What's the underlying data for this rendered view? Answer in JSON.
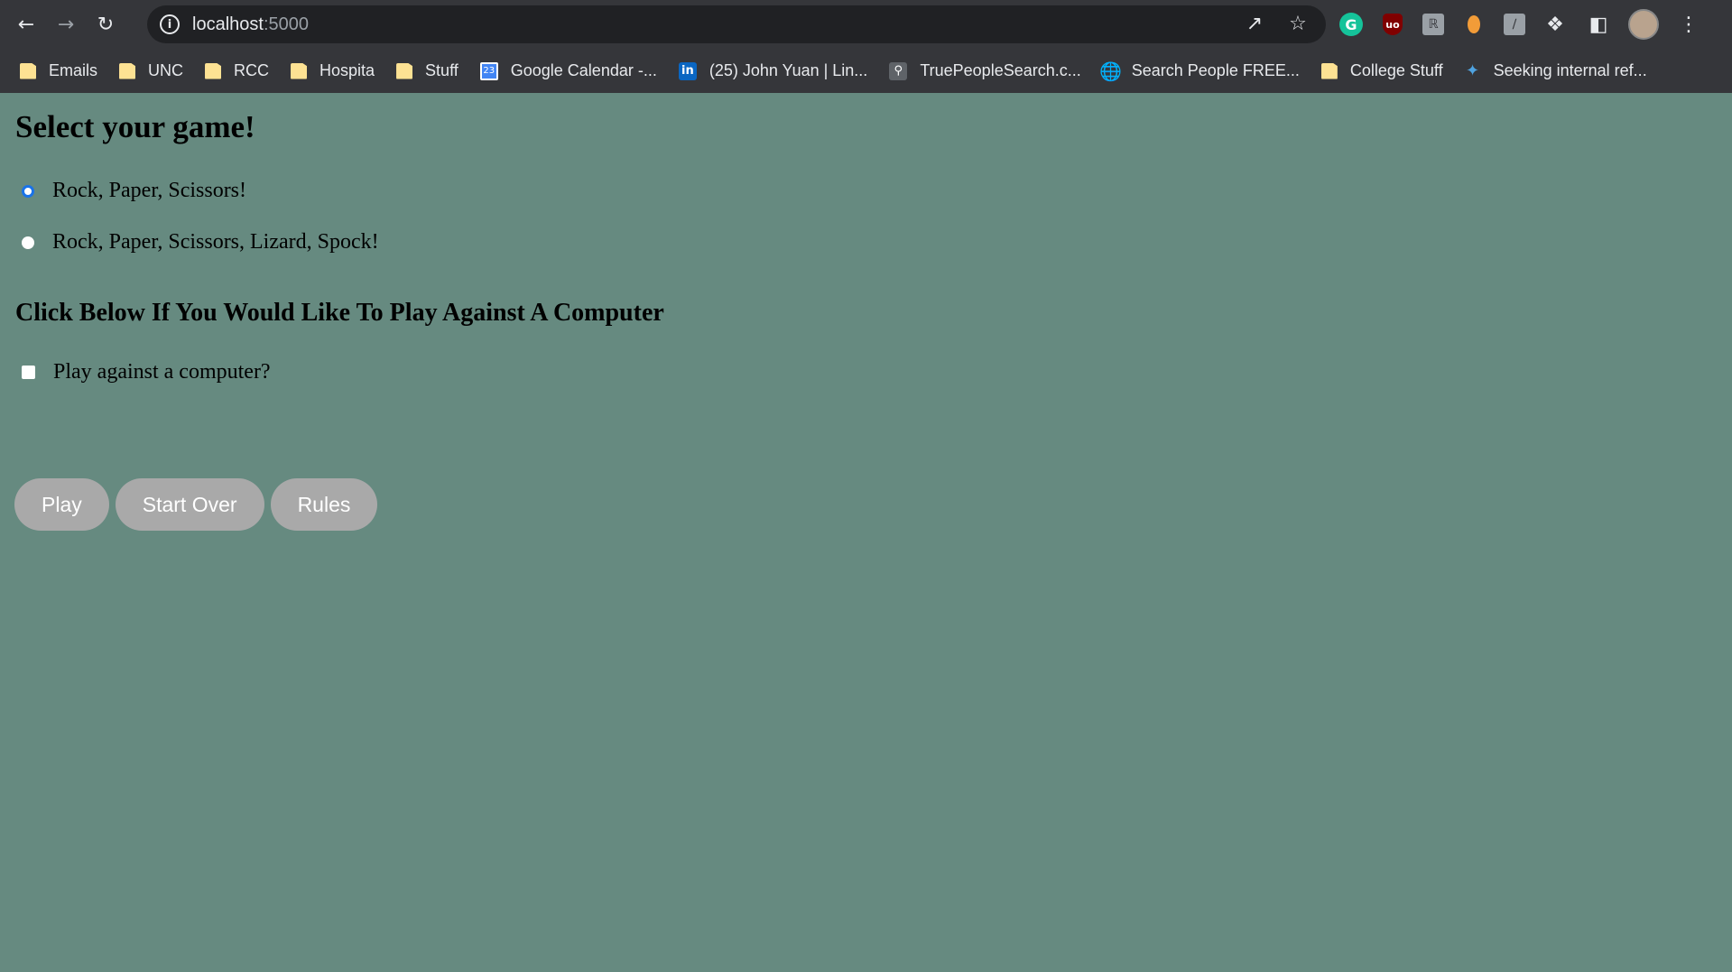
{
  "browser": {
    "url_host": "localhost",
    "url_port": ":5000",
    "bookmarks": [
      {
        "label": "Emails",
        "icon": "folder-icon"
      },
      {
        "label": "UNC",
        "icon": "folder-icon"
      },
      {
        "label": "RCC",
        "icon": "folder-icon"
      },
      {
        "label": "Hospita",
        "icon": "folder-icon"
      },
      {
        "label": "Stuff",
        "icon": "folder-icon"
      },
      {
        "label": "Google Calendar -...",
        "icon": "google-calendar-icon"
      },
      {
        "label": "(25) John Yuan | Lin...",
        "icon": "linkedin-icon"
      },
      {
        "label": "TruePeopleSearch.c...",
        "icon": "search-icon"
      },
      {
        "label": "Search People FREE...",
        "icon": "globe-icon"
      },
      {
        "label": "College Stuff",
        "icon": "folder-icon"
      },
      {
        "label": "Seeking internal ref...",
        "icon": "bird-icon"
      }
    ],
    "calendar_day": "23"
  },
  "page": {
    "title": "Select your game!",
    "game_options": [
      {
        "label": "Rock, Paper, Scissors!",
        "selected": true
      },
      {
        "label": "Rock, Paper, Scissors, Lizard, Spock!",
        "selected": false
      }
    ],
    "computer_heading": "Click Below If You Would Like To Play Against A Computer",
    "computer_checkbox_label": "Play against a computer?",
    "computer_checked": false,
    "buttons": {
      "play": "Play",
      "start_over": "Start Over",
      "rules": "Rules"
    }
  },
  "colors": {
    "page_background": "#668a80",
    "button_background": "#a9a9a9",
    "radio_accent": "#1a73e8"
  }
}
